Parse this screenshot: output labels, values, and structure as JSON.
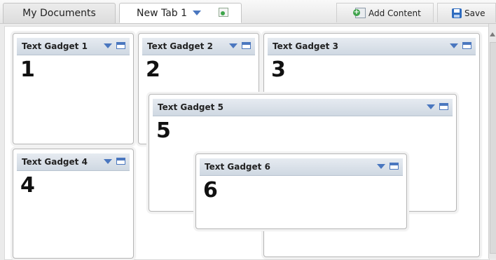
{
  "tabs": {
    "my_documents": "My Documents",
    "new_tab": "New Tab 1"
  },
  "toolbar": {
    "add_content": "Add Content",
    "save": "Save"
  },
  "gadgets": [
    {
      "title": "Text Gadget 1",
      "content": "1"
    },
    {
      "title": "Text Gadget 2",
      "content": "2"
    },
    {
      "title": "Text Gadget 3",
      "content": "3"
    },
    {
      "title": "Text Gadget 4",
      "content": "4"
    },
    {
      "title": "Text Gadget 5",
      "content": "5"
    },
    {
      "title": "Text Gadget 6",
      "content": "6"
    }
  ],
  "colors": {
    "accent_blue": "#4a77bf",
    "header_gradient_top": "#e6ebf1",
    "header_gradient_bottom": "#cfd8e2"
  },
  "icons": {
    "dropdown": "triangle-down",
    "maximize": "window-maximize",
    "new_tab": "add-tab",
    "add_content": "add-content",
    "save": "floppy-disk"
  }
}
